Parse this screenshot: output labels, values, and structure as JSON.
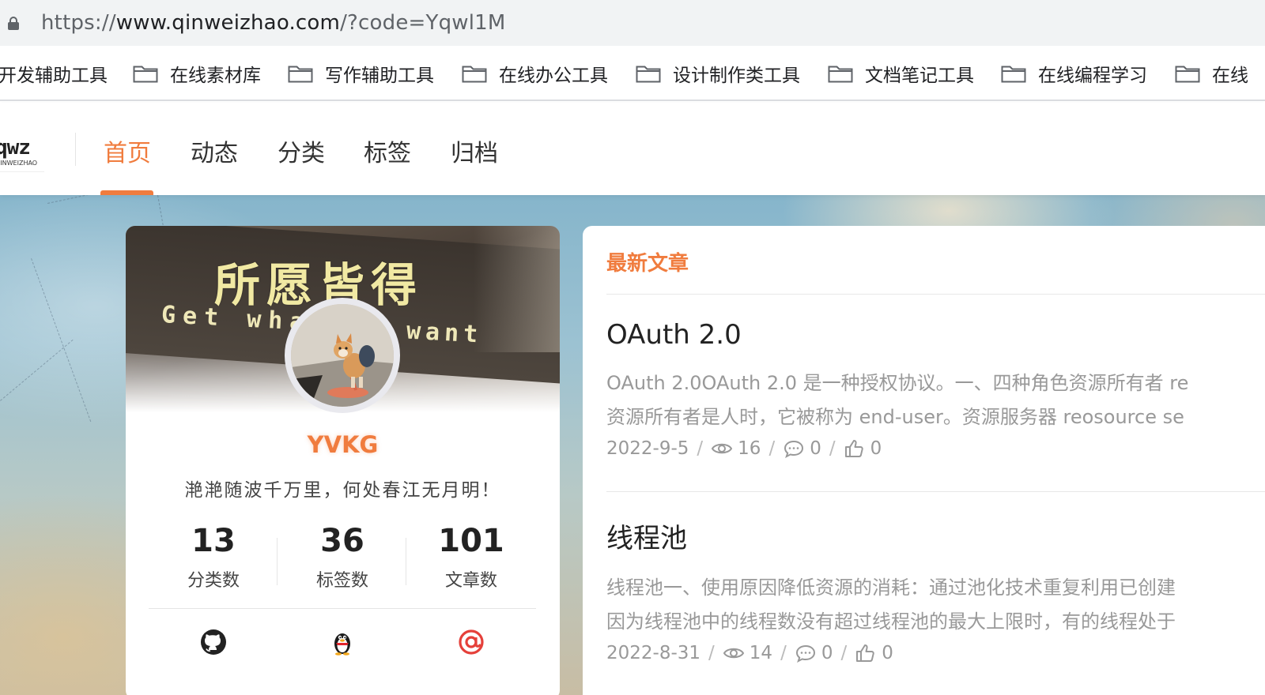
{
  "browser": {
    "url_scheme": "https://",
    "url_host": "www.qinweizhao.com",
    "url_path": "/?code=Yqwl1M"
  },
  "bookmarks": [
    {
      "label": "开发辅助工具",
      "icon": "folder-icon"
    },
    {
      "label": "在线素材库",
      "icon": "folder-icon"
    },
    {
      "label": "写作辅助工具",
      "icon": "folder-icon"
    },
    {
      "label": "在线办公工具",
      "icon": "folder-icon"
    },
    {
      "label": "设计制作类工具",
      "icon": "folder-icon"
    },
    {
      "label": "文档笔记工具",
      "icon": "folder-icon"
    },
    {
      "label": "在线编程学习",
      "icon": "folder-icon"
    },
    {
      "label": "在线",
      "icon": "folder-icon"
    }
  ],
  "site": {
    "logo_main": "qwz",
    "logo_sub": "QINWEIZHAO",
    "nav": [
      {
        "label": "首页",
        "active": true
      },
      {
        "label": "动态",
        "active": false
      },
      {
        "label": "分类",
        "active": false
      },
      {
        "label": "标签",
        "active": false
      },
      {
        "label": "归档",
        "active": false
      }
    ],
    "accent_color": "#f07c3e"
  },
  "profile": {
    "banner_cn": "所愿皆得",
    "banner_en_left": "Get wha",
    "banner_en_right": "want",
    "username": "YVKG",
    "motto": "滟滟随波千万里，何处春江无月明！",
    "stats": [
      {
        "value": "13",
        "label": "分类数"
      },
      {
        "value": "36",
        "label": "标签数"
      },
      {
        "value": "101",
        "label": "文章数"
      }
    ],
    "social": [
      {
        "icon": "github-icon"
      },
      {
        "icon": "qq-penguin-icon"
      },
      {
        "icon": "email-at-icon"
      }
    ]
  },
  "latest": {
    "title": "最新文章",
    "articles": [
      {
        "title": "OAuth 2.0",
        "excerpt_line1": "OAuth 2.0OAuth 2.0 是一种授权协议。一、四种角色资源所有者 re",
        "excerpt_line2": "资源所有者是人时，它被称为 end-user。资源服务器 reosource se",
        "date": "2022-9-5",
        "views": "16",
        "comments": "0",
        "likes": "0"
      },
      {
        "title": "线程池",
        "excerpt_line1": "线程池一、使用原因降低资源的消耗：通过池化技术重复利用已创建",
        "excerpt_line2": "因为线程池中的线程数没有超过线程池的最大上限时，有的线程处于",
        "date": "2022-8-31",
        "views": "14",
        "comments": "0",
        "likes": "0"
      }
    ]
  }
}
